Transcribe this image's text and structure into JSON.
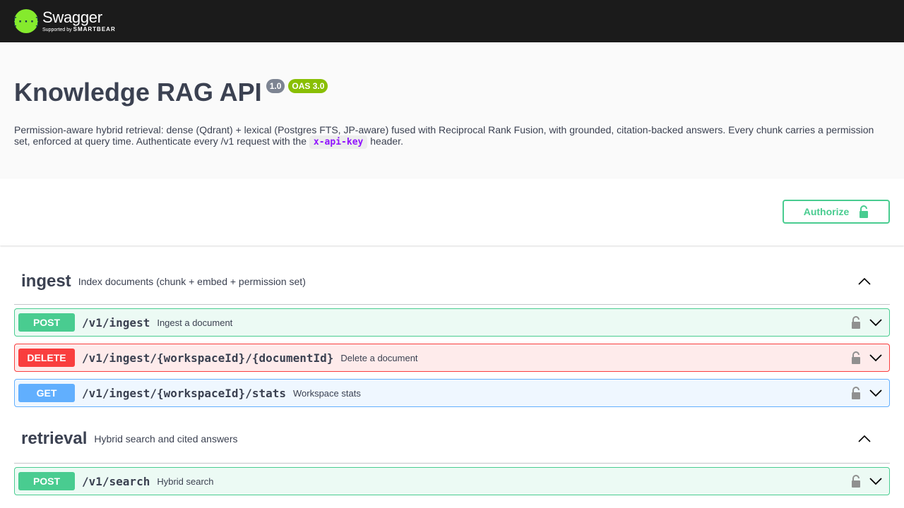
{
  "topbar": {
    "logo_name": "Swagger",
    "logo_sub_prefix": "Supported by",
    "logo_sub_brand": "SMARTBEAR",
    "brand_color": "#85ea2d"
  },
  "info": {
    "title": "Knowledge RAG API",
    "version": "1.0",
    "oas": "OAS 3.0",
    "description_pre": "Permission-aware hybrid retrieval: dense (Qdrant) + lexical (Postgres FTS, JP-aware) fused with Reciprocal Rank Fusion, with grounded, citation-backed answers. Every chunk carries a permission set, enforced at query time. Authenticate every /v1 request with the ",
    "description_code": "x-api-key",
    "description_post": " header."
  },
  "auth": {
    "label": "Authorize",
    "icon": "lock-icon"
  },
  "tags": [
    {
      "name": "ingest",
      "description": "Index documents (chunk + embed + permission set)",
      "ops": [
        {
          "method": "POST",
          "path": "/v1/ingest",
          "summary": "Ingest a document"
        },
        {
          "method": "DELETE",
          "path": "/v1/ingest/{workspaceId}/{documentId}",
          "summary": "Delete a document"
        },
        {
          "method": "GET",
          "path": "/v1/ingest/{workspaceId}/stats",
          "summary": "Workspace stats"
        }
      ]
    },
    {
      "name": "retrieval",
      "description": "Hybrid search and cited answers",
      "ops": [
        {
          "method": "POST",
          "path": "/v1/search",
          "summary": "Hybrid search"
        }
      ]
    }
  ],
  "colors": {
    "post": "#49cc90",
    "delete": "#f93e3e",
    "get": "#61affe",
    "text": "#3b4151"
  }
}
